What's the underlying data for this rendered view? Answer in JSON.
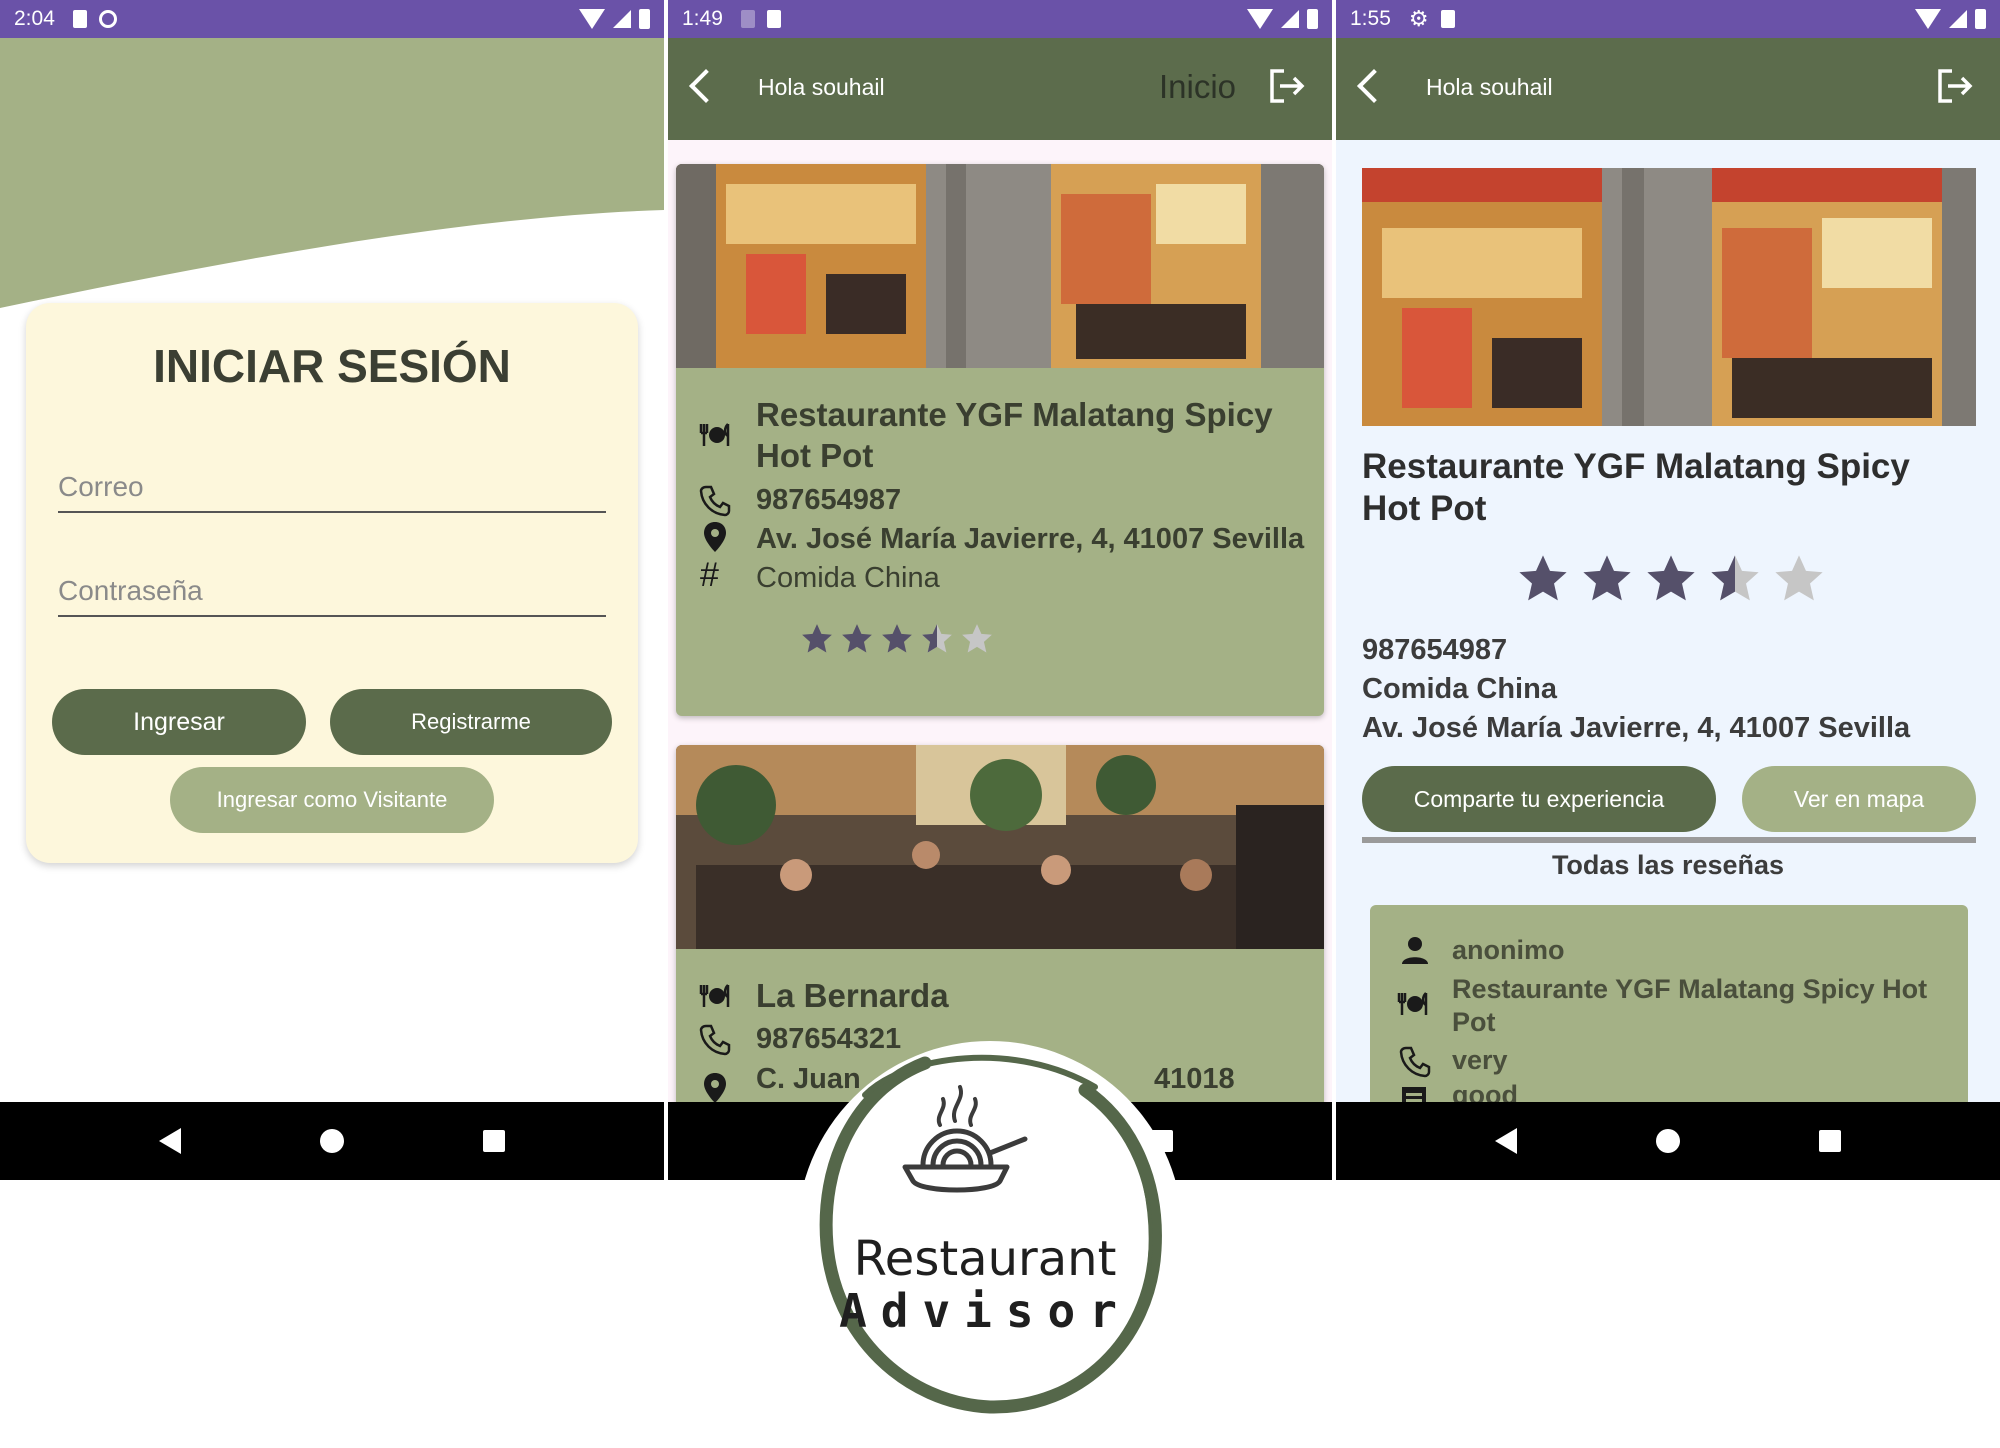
{
  "phone1": {
    "status": {
      "time": "2:04"
    },
    "login": {
      "title": "INICIAR SESIÓN",
      "email_placeholder": "Correo",
      "password_placeholder": "Contraseña",
      "login_button": "Ingresar",
      "register_button": "Registrarme",
      "guest_button": "Ingresar como Visitante"
    }
  },
  "phone2": {
    "status": {
      "time": "1:49"
    },
    "topbar": {
      "greeting": "Hola souhail",
      "title": "Inicio"
    },
    "restaurants": [
      {
        "name": "Restaurante YGF Malatang Spicy Hot Pot",
        "phone": "987654987",
        "address": "Av. José María Javierre, 4, 41007 Sevilla",
        "category": "Comida China",
        "rating": 3.5
      },
      {
        "name": "La Bernarda",
        "phone": "987654321",
        "address_visible_start": "C. Juan",
        "address_visible_end": "41018"
      }
    ]
  },
  "phone3": {
    "status": {
      "time": "1:55"
    },
    "topbar": {
      "greeting": "Hola souhail"
    },
    "detail": {
      "name": "Restaurante YGF Malatang Spicy Hot Pot",
      "rating": 3.5,
      "phone": "987654987",
      "category": "Comida China",
      "address": "Av. José María Javierre, 4, 41007 Sevilla",
      "share_button": "Comparte tu experiencia",
      "map_button": "Ver en mapa",
      "reviews_title": "Todas las reseñas"
    },
    "review": {
      "user": "anonimo",
      "restaurant": "Restaurante YGF Malatang Spicy Hot Pot",
      "text_line1": "very",
      "text_line2": "good"
    }
  },
  "logo": {
    "line1": "Restaurant",
    "line2": "Advisor"
  },
  "colors": {
    "status_bar": "#6a52a8",
    "app_bar": "#5c6c4c",
    "sage": "#a4b186",
    "cream": "#fdf7dc",
    "star": "#55506a"
  }
}
